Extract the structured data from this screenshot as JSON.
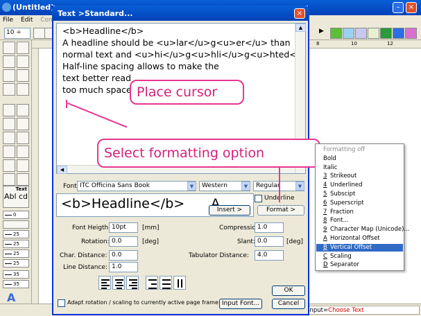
{
  "app": {
    "title": "(Untitled)",
    "menus": [
      "File",
      "Edit",
      "Config"
    ],
    "zoom": "10",
    "status_input_label": "Input=",
    "status_input_value": "Choose Text",
    "ruler_marks": [
      "8",
      "10",
      "12"
    ]
  },
  "toolbox": {
    "text_tool_label": "Text",
    "text_sample": "Abl cd",
    "line_widths": [
      "0",
      "25",
      "25",
      "25",
      "25",
      "35",
      "35"
    ]
  },
  "dialog": {
    "title": "Text >Standard...",
    "editor_lines": [
      "<b>Headline</b>",
      "A headline should be <u>lar</u>g<u>er</u> than",
      "normal text and <u>hi</u>g<u>hli</u>g<u>hted</u>",
      "Half-line spacing allows to make the",
      "text better read",
      "too much space"
    ],
    "font_label": "Font:",
    "font_value": "ITC Officina Sans Book",
    "script_value": "Western",
    "style_value": "Regular",
    "underline_label": "Underline",
    "preview_text": "<b>Headline</b>",
    "preview_tail": "A",
    "insert_label": "Insert >",
    "format_label": "Format >",
    "fields": {
      "font_height_label": "Font Heigth:",
      "font_height_value": "10pt",
      "font_height_unit": "[mm]",
      "rotation_label": "Rotation:",
      "rotation_value": "0.0",
      "rotation_unit": "[deg]",
      "char_distance_label": "Char. Distance:",
      "char_distance_value": "0.0",
      "line_distance_label": "Line Distance:",
      "line_distance_value": "1.0",
      "compression_label": "Compression:",
      "compression_value": "1.0",
      "slant_label": "Slant:",
      "slant_value": "0.0",
      "slant_unit": "[deg]",
      "tab_distance_label": "Tabulator Distance:",
      "tab_distance_value": "4.0"
    },
    "ok_label": "OK",
    "cancel_label": "Cancel",
    "input_font_label": "Input Font...",
    "adapt_label": "Adapt rotation / scaling to currently active page frame"
  },
  "callouts": {
    "place_cursor": "Place cursor",
    "select_format": "Select formatting option"
  },
  "format_menu": {
    "items": [
      {
        "key": "",
        "label": "Formatting off",
        "state": "disabled"
      },
      {
        "key": "",
        "label": "Bold",
        "state": "normal"
      },
      {
        "key": "",
        "label": "Italic",
        "state": "normal"
      },
      {
        "key": "3",
        "label": "Strikeout",
        "state": "normal"
      },
      {
        "key": "4",
        "label": "Underlined",
        "state": "normal"
      },
      {
        "key": "5",
        "label": "Subscipt",
        "state": "normal"
      },
      {
        "key": "6",
        "label": "Superscript",
        "state": "normal"
      },
      {
        "key": "7",
        "label": "Fraction",
        "state": "normal"
      },
      {
        "key": "8",
        "label": "Font...",
        "state": "normal"
      },
      {
        "key": "9",
        "label": "Character Map (Unicode)...",
        "state": "normal"
      },
      {
        "key": "A",
        "label": "Horizontal Offset",
        "state": "normal"
      },
      {
        "key": "B",
        "label": "Vertical Offset",
        "state": "selected"
      },
      {
        "key": "C",
        "label": "Scaling",
        "state": "normal"
      },
      {
        "key": "D",
        "label": "Separator",
        "state": "normal"
      }
    ]
  },
  "colors": {
    "accent": "#0a5fd6",
    "callout": "#e8358f",
    "selection": "#316ac5"
  }
}
